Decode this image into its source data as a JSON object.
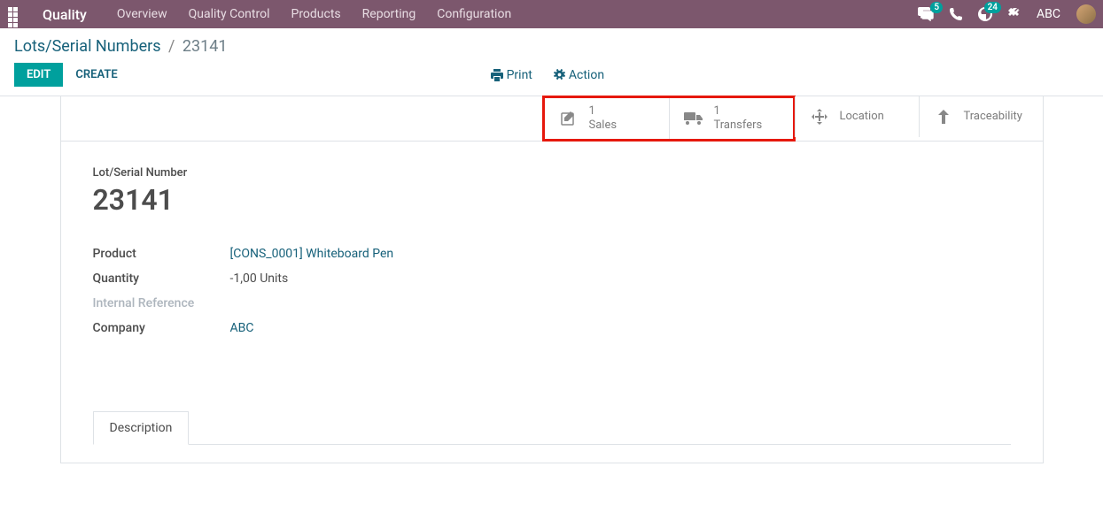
{
  "topbar": {
    "app_name": "Quality",
    "menu": [
      "Overview",
      "Quality Control",
      "Products",
      "Reporting",
      "Configuration"
    ],
    "messages_badge": "5",
    "activities_badge": "24",
    "user_name": "ABC"
  },
  "breadcrumb": {
    "parent": "Lots/Serial Numbers",
    "current": "23141"
  },
  "buttons": {
    "edit": "EDIT",
    "create": "CREATE",
    "print": "Print",
    "action": "Action"
  },
  "stat_buttons": {
    "sales": {
      "count": "1",
      "label": "Sales"
    },
    "transfers": {
      "count": "1",
      "label": "Transfers"
    },
    "location": {
      "label": "Location"
    },
    "traceability": {
      "label": "Traceability"
    }
  },
  "record": {
    "label_lot": "Lot/Serial Number",
    "lot_value": "23141",
    "label_product": "Product",
    "product_value": "[CONS_0001] Whiteboard Pen",
    "label_quantity": "Quantity",
    "quantity_value": "-1,00",
    "quantity_uom": "Units",
    "label_internal_ref": "Internal Reference",
    "label_company": "Company",
    "company_value": "ABC"
  },
  "tabs": {
    "description": "Description"
  }
}
